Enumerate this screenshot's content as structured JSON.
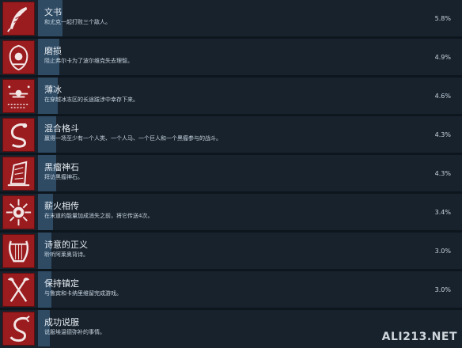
{
  "achievements": [
    {
      "title": "文书",
      "desc": "和尤克一起打败三个敌人。",
      "pct": "5.8%",
      "percent_value": 5.8,
      "icon": "quill-icon"
    },
    {
      "title": "磨损",
      "desc": "阻止弗尔卡为了波尔维克失去理智。",
      "pct": "4.9%",
      "percent_value": 4.9,
      "icon": "worn-shield-icon"
    },
    {
      "title": "薄冰",
      "desc": "在穿越冰冻区的长途跋涉中幸存下来。",
      "pct": "4.6%",
      "percent_value": 4.6,
      "icon": "thin-ice-icon"
    },
    {
      "title": "混合格斗",
      "desc": "赢得一场至少有一个人类、一个人马、一个巨人和一个黑瘤参与的战斗。",
      "pct": "4.3%",
      "percent_value": 4.3,
      "icon": "serpent-fight-icon"
    },
    {
      "title": "黑瘤神石",
      "desc": "拜访黑瘤神石。",
      "pct": "4.3%",
      "percent_value": 4.3,
      "icon": "stone-icon"
    },
    {
      "title": "薪火相传",
      "desc": "在末道的能量加成消失之前，将它传送4次。",
      "pct": "3.4%",
      "percent_value": 3.4,
      "icon": "sun-icon"
    },
    {
      "title": "诗意的正义",
      "desc": "聆听阿莱奥背诗。",
      "pct": "3.0%",
      "percent_value": 3.0,
      "icon": "lyre-icon"
    },
    {
      "title": "保持镇定",
      "desc": "与鲁宾和卡纳里维留完成游戏。",
      "pct": "3.0%",
      "percent_value": 3.0,
      "icon": "axes-icon"
    },
    {
      "title": "成功说服",
      "desc": "说服埃温德弥补的事情。",
      "pct": "",
      "percent_value": null,
      "icon": "dragon-icon"
    }
  ],
  "watermark": "ALI213.NET"
}
